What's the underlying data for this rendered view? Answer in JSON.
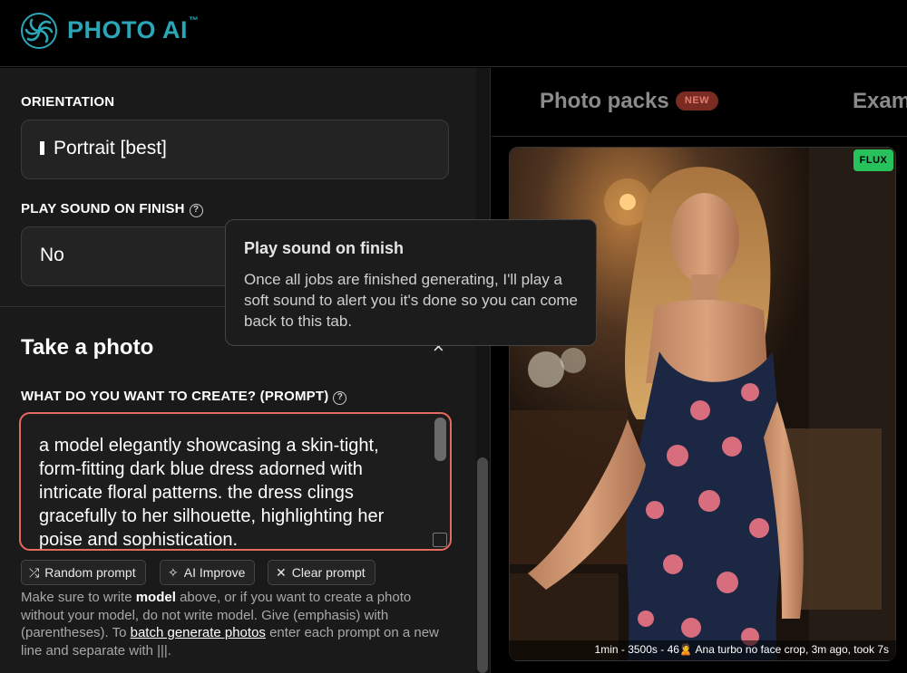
{
  "app": {
    "name": "PHOTO AI",
    "trademark": "™"
  },
  "orientation": {
    "label": "ORIENTATION",
    "value": "Portrait [best]"
  },
  "sound": {
    "label": "PLAY SOUND ON FINISH",
    "value": "No"
  },
  "tooltip": {
    "title": "Play sound on finish",
    "body": "Once all jobs are finished generating, I'll play a soft sound to alert you it's done so you can come back to this tab."
  },
  "take_photo": {
    "title": "Take a photo",
    "close": "×",
    "prompt_label": "WHAT DO YOU WANT TO CREATE? (PROMPT)",
    "prompt_value": "a model elegantly showcasing a skin-tight, form-fitting dark blue dress adorned with intricate floral patterns. the dress clings gracefully to her silhouette, highlighting her poise and sophistication.",
    "buttons": {
      "random": "Random prompt",
      "improve": "AI Improve",
      "clear": "Clear prompt"
    },
    "help": {
      "p1": "Make sure to write ",
      "model": "model",
      "p2": " above, or if you want to create a photo without your model, do not write model. Give (emphasis) with (parentheses). To ",
      "batch": "batch generate photos",
      "p3": " enter each prompt on a new line and separate with |||."
    }
  },
  "tabs": {
    "photo_packs": "Photo packs",
    "new_badge": "NEW",
    "examples": "Exam"
  },
  "photo": {
    "badge": "FLUX",
    "caption": "1min - 3500s - 46🙎 Ana turbo no face crop, 3m ago, took 7s"
  },
  "colors": {
    "brand": "#2aa6b8",
    "prompt_border": "#e66a5d",
    "flux_badge": "#27c25c",
    "new_badge": "#7a2c22"
  }
}
